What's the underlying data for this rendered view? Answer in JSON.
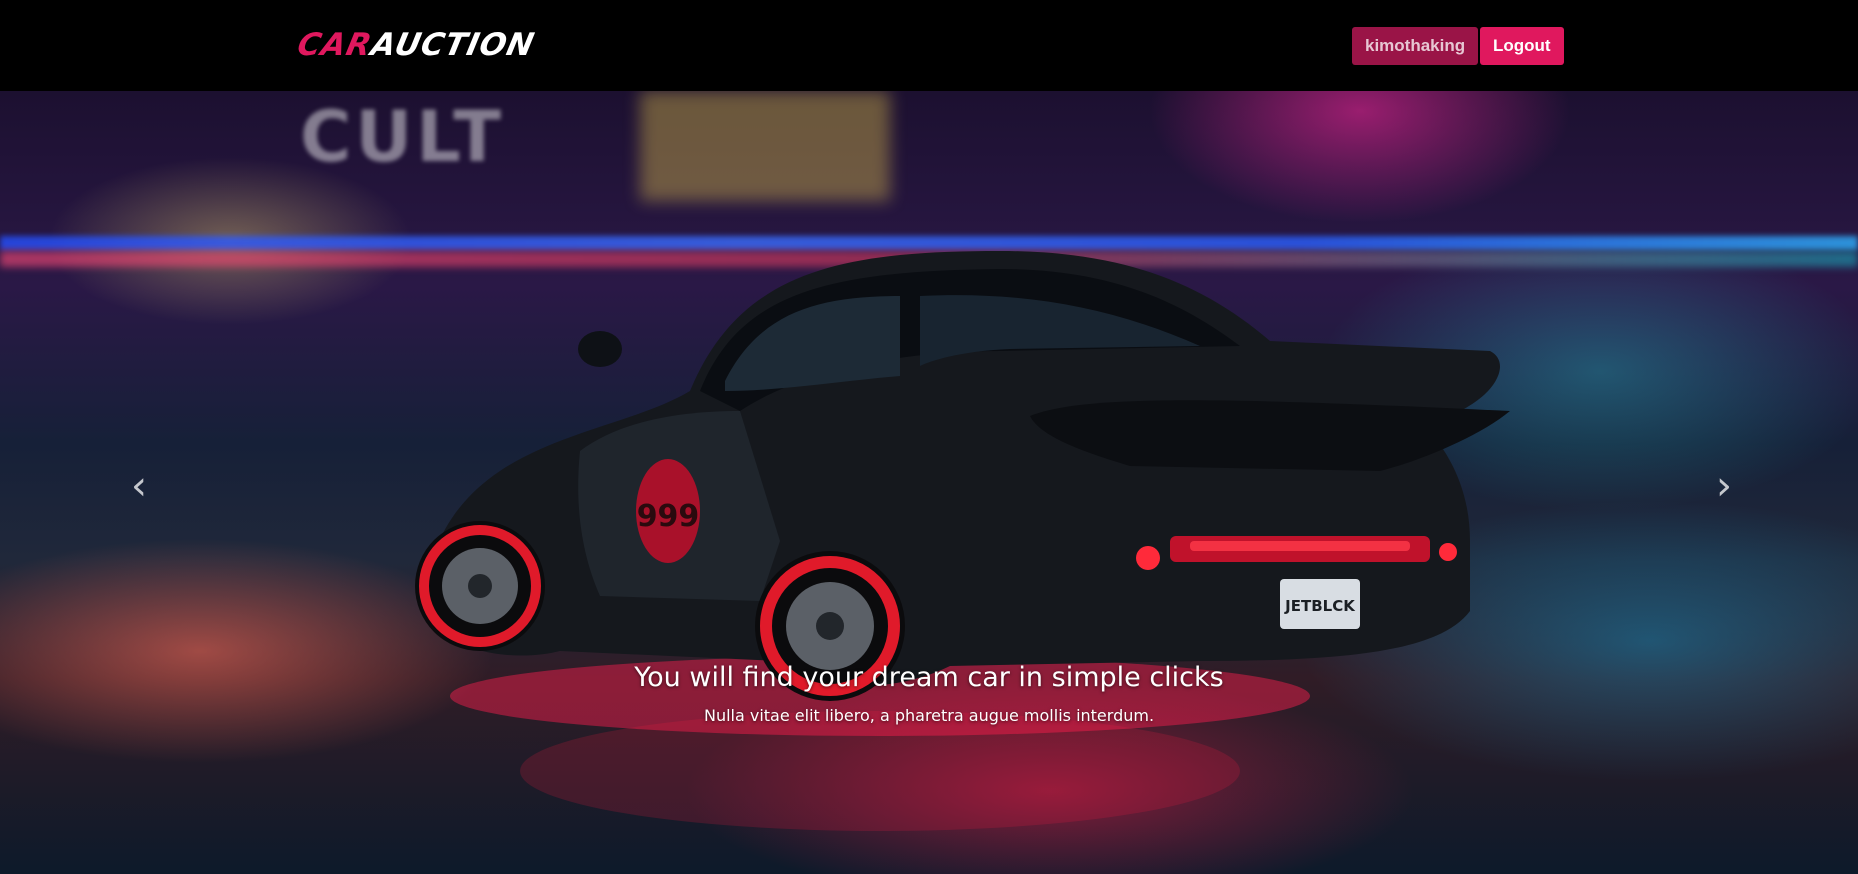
{
  "header": {
    "logo_part1": "CAR",
    "logo_part2": "AUCTION",
    "user_button": "kimothaking",
    "logout_button": "Logout"
  },
  "carousel": {
    "caption_title": "You will find your dream car in simple clicks",
    "caption_text": "Nulla vitae elit libero, a pharetra augue mollis interdum.",
    "background_sign": "CULT",
    "car_number": "999",
    "car_plate": "JETBLCK",
    "prev_icon": "chevron-left-icon",
    "next_icon": "chevron-right-icon"
  },
  "colors": {
    "accent": "#e0185e",
    "user_button_bg": "#9a1447",
    "navbar_bg": "#000000"
  }
}
